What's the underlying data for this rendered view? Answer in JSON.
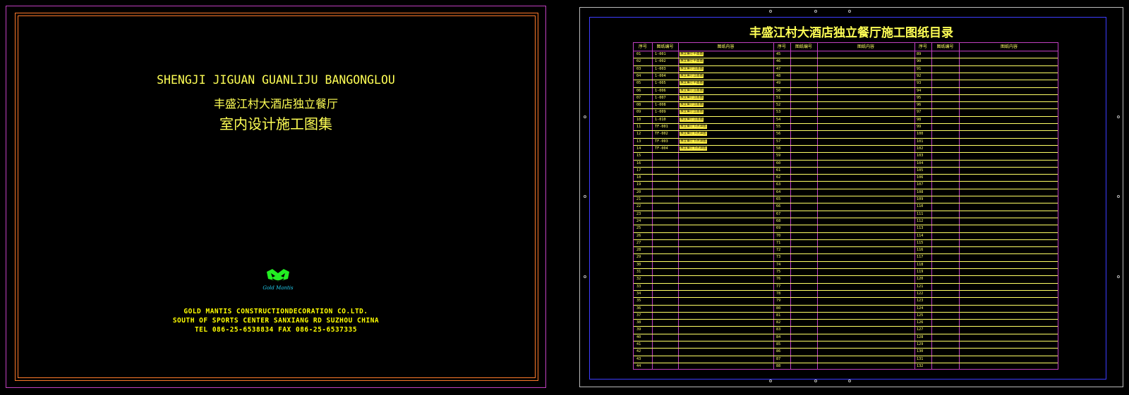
{
  "cover": {
    "title_en": "SHENGJI JIGUAN GUANLIJU BANGONGLOU",
    "title_cn_1": "丰盛江村大酒店独立餐厅",
    "title_cn_2": "室内设计施工图集",
    "logo_text": "Gold Mantis",
    "company_lines": [
      "GOLD MANTIS CONSTRUCTIONDECORATION CO.LTD.",
      "SOUTH OF SPORTS CENTER SANXIANG RD SUZHOU CHINA",
      "TEL 086-25-6538834  FAX 086-25-6537335"
    ]
  },
  "index": {
    "title": "丰盛江村大酒店独立餐厅施工图纸目录",
    "headers": [
      "序号",
      "图纸编号",
      "图纸内容",
      "序号",
      "图纸编号",
      "图纸内容",
      "序号",
      "图纸编号",
      "图纸内容"
    ],
    "drawing_codes": [
      "1-001",
      "1-002",
      "1-003",
      "1-004",
      "1-005",
      "1-006",
      "1-007",
      "1-008",
      "1-009",
      "1-010",
      "TF-001",
      "TF-002",
      "TF-003",
      "TF-004"
    ],
    "drawing_contents": [
      "独立餐厅平面图",
      "独立餐厅平面图",
      "独立餐厅立面图",
      "独立餐厅立面图",
      "独立餐厅平面图",
      "独立餐厅立面图",
      "独立餐厅立面图",
      "独立餐厅立面图",
      "独立餐厅立面图",
      "独立餐厅立面图",
      "独立餐厅节点详图",
      "独立餐厅节点详图",
      "独立餐厅节点详图",
      "独立餐厅节点详图"
    ],
    "col1_start": 1,
    "col2_start": 45,
    "col3_start": 89,
    "rows": 44
  },
  "colors": {
    "text": "#ffff55",
    "frame_orange": "#ff7a2a",
    "frame_magenta": "#c040c0",
    "frame_blue": "#3d3dff",
    "logo_green": "#22ee22"
  }
}
